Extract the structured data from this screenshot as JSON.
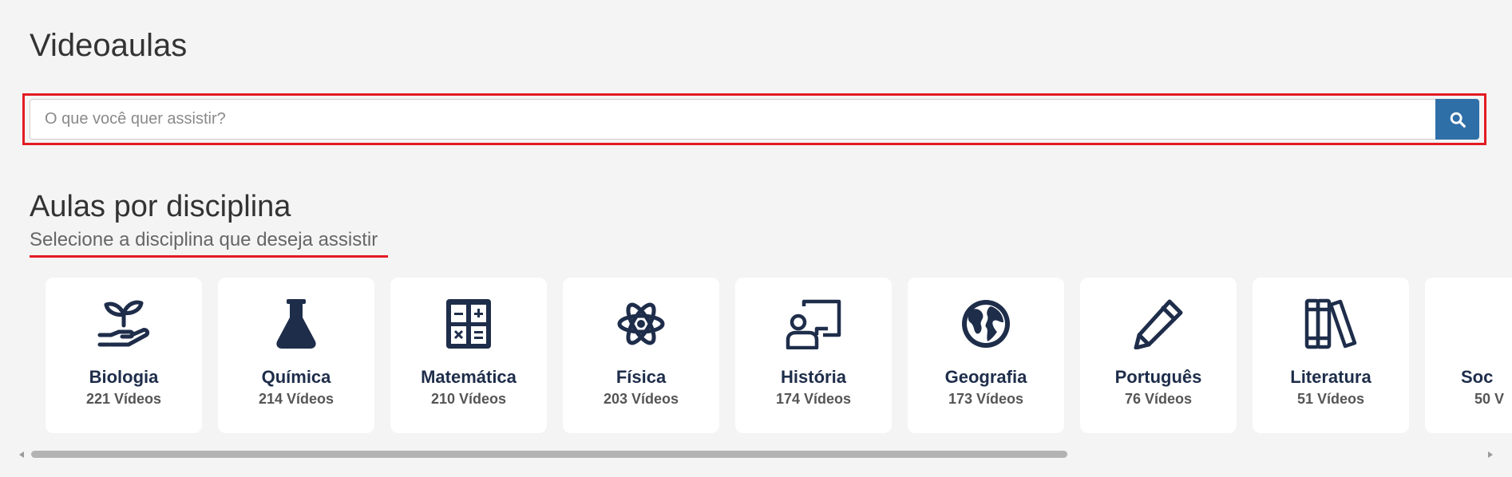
{
  "header": {
    "title": "Videoaulas"
  },
  "search": {
    "placeholder": "O que você quer assistir?",
    "value": "",
    "button_icon": "search-icon",
    "highlight_color": "#e31b23",
    "button_color": "#2f6fa8"
  },
  "section": {
    "title": "Aulas por disciplina",
    "subtitle": "Selecione a disciplina que deseja assistir"
  },
  "subjects": [
    {
      "id": "biologia",
      "name": "Biologia",
      "count": "221 Vídeos",
      "icon": "plant-hand-icon"
    },
    {
      "id": "quimica",
      "name": "Química",
      "count": "214 Vídeos",
      "icon": "flask-icon"
    },
    {
      "id": "matematica",
      "name": "Matemática",
      "count": "210 Vídeos",
      "icon": "calculator-icon"
    },
    {
      "id": "fisica",
      "name": "Física",
      "count": "203 Vídeos",
      "icon": "atom-icon"
    },
    {
      "id": "historia",
      "name": "História",
      "count": "174 Vídeos",
      "icon": "teacher-board-icon"
    },
    {
      "id": "geografia",
      "name": "Geografia",
      "count": "173 Vídeos",
      "icon": "globe-icon"
    },
    {
      "id": "portugues",
      "name": "Português",
      "count": "76 Vídeos",
      "icon": "pencil-icon"
    },
    {
      "id": "literatura",
      "name": "Literatura",
      "count": "51 Vídeos",
      "icon": "books-icon"
    },
    {
      "id": "sociologia",
      "name": "Soc",
      "count": "50 V",
      "icon": "head-icon"
    }
  ],
  "colors": {
    "icon": "#1e2d4a",
    "accent": "#e31b23"
  }
}
